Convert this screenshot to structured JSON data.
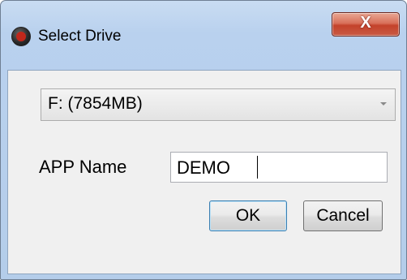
{
  "window": {
    "title": "Select Drive",
    "app_icon": "app-logo-icon",
    "close_label": "X"
  },
  "drive_select": {
    "selected": "F: (7854MB)",
    "arrow_icon": "chevron-down-icon"
  },
  "app_name": {
    "label": "APP Name",
    "value": "DEMO"
  },
  "buttons": {
    "ok": "OK",
    "cancel": "Cancel"
  }
}
